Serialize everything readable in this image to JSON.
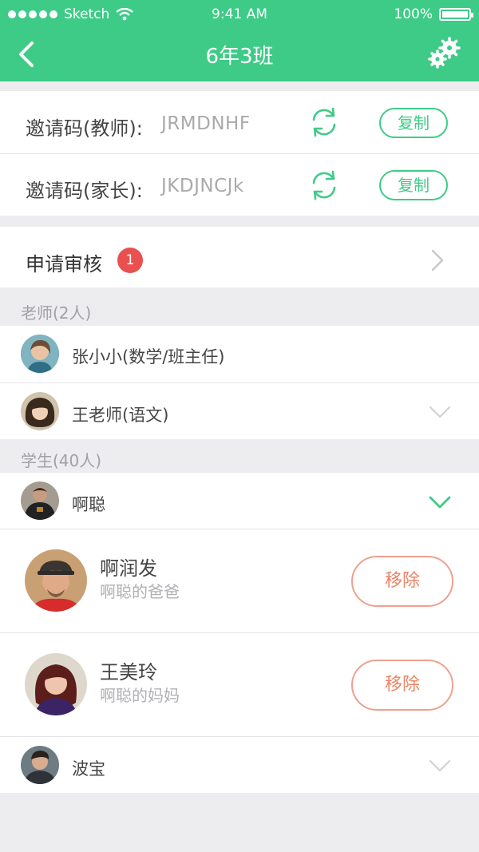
{
  "status_bar": {
    "carrier": "Sketch",
    "time": "9:41 AM",
    "battery": "100%"
  },
  "nav": {
    "title": "6年3班"
  },
  "invite_codes": [
    {
      "label": "邀请码(教师):",
      "code": "JRMDNHF",
      "copy_label": "复制"
    },
    {
      "label": "邀请码(家长):",
      "code": "JKDJNCJk",
      "copy_label": "复制"
    }
  ],
  "apply": {
    "label": "申请审核",
    "badge": "1"
  },
  "teachers": {
    "title": "老师(2人)",
    "items": [
      {
        "name": "张小小(数学/班主任)"
      },
      {
        "name": "王老师(语文)"
      }
    ]
  },
  "students": {
    "title": "学生(40人)",
    "items": [
      {
        "name": "啊聪",
        "expanded": true,
        "parents": [
          {
            "name": "啊润发",
            "relation": "啊聪的爸爸",
            "action": "移除"
          },
          {
            "name": "王美玲",
            "relation": "啊聪的妈妈",
            "action": "移除"
          }
        ]
      },
      {
        "name": "波宝",
        "expanded": false
      }
    ]
  },
  "colors": {
    "brand": "#3ecb87",
    "badge": "#ea5050",
    "remove": "#ec8466"
  }
}
